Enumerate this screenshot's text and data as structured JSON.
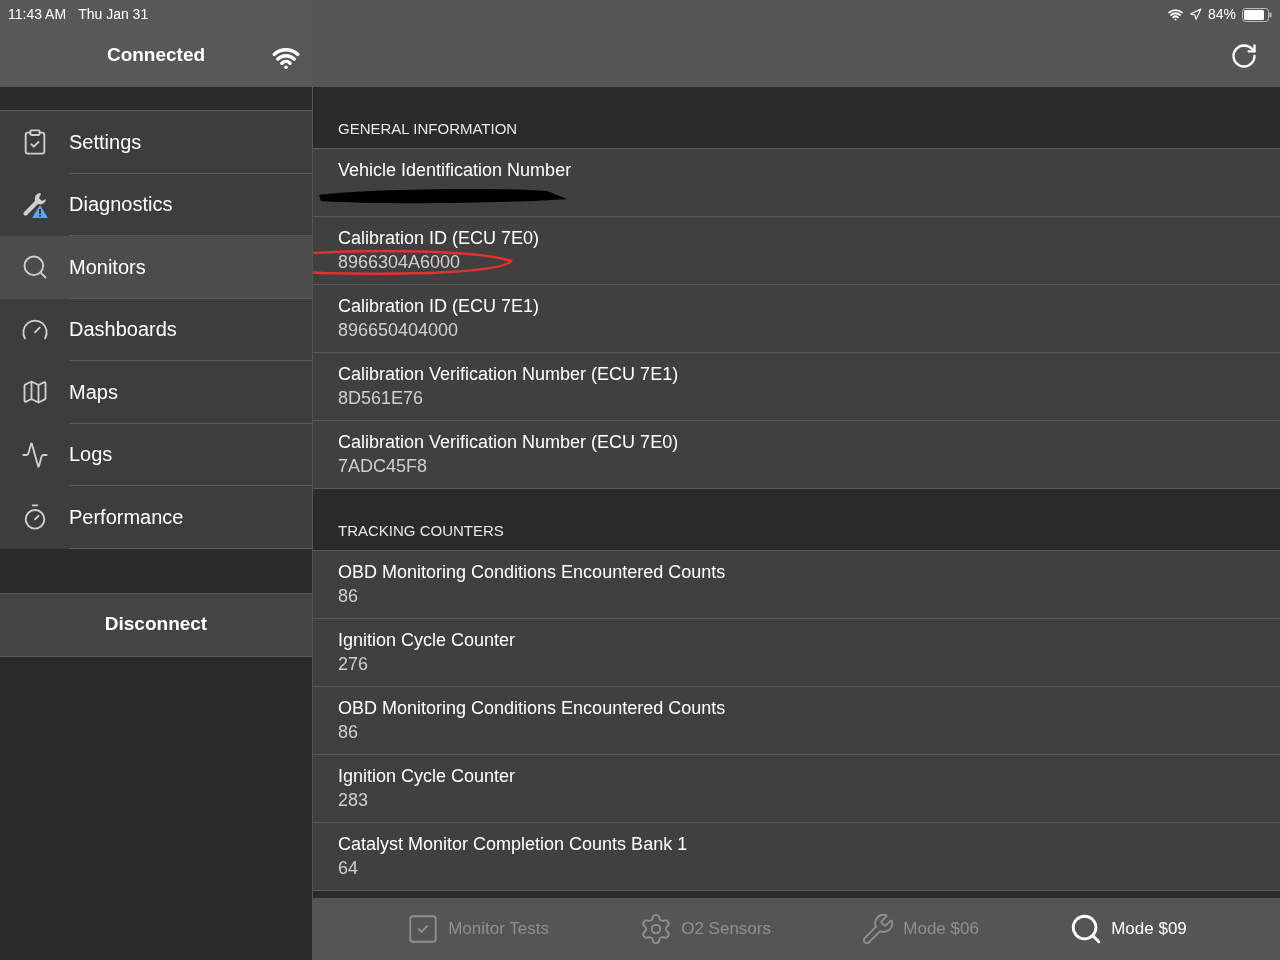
{
  "status_bar": {
    "time": "11:43 AM",
    "date": "Thu Jan 31",
    "battery": "84%"
  },
  "sidebar": {
    "title": "Connected",
    "items": [
      {
        "label": "Settings",
        "selected": false
      },
      {
        "label": "Diagnostics",
        "selected": false
      },
      {
        "label": "Monitors",
        "selected": true
      },
      {
        "label": "Dashboards",
        "selected": false
      },
      {
        "label": "Maps",
        "selected": false
      },
      {
        "label": "Logs",
        "selected": false
      },
      {
        "label": "Performance",
        "selected": false
      }
    ],
    "disconnect": "Disconnect"
  },
  "sections": [
    {
      "title": "GENERAL INFORMATION",
      "rows": [
        {
          "kind": "redacted",
          "label": "Vehicle Identification Number",
          "highlighted": false
        },
        {
          "kind": "text",
          "label": "Calibration ID (ECU 7E0)",
          "value": "8966304A6000",
          "highlighted": true
        },
        {
          "kind": "text",
          "label": "Calibration ID (ECU 7E1)",
          "value": "896650404000",
          "highlighted": false
        },
        {
          "kind": "text",
          "label": "Calibration Verification Number (ECU 7E1)",
          "value": "8D561E76",
          "highlighted": false
        },
        {
          "kind": "text",
          "label": "Calibration Verification Number (ECU 7E0)",
          "value": "7ADC45F8",
          "highlighted": false
        }
      ]
    },
    {
      "title": "TRACKING COUNTERS",
      "rows": [
        {
          "kind": "text",
          "label": "OBD Monitoring Conditions Encountered Counts",
          "value": "86",
          "highlighted": false
        },
        {
          "kind": "text",
          "label": "Ignition Cycle Counter",
          "value": "276",
          "highlighted": false
        },
        {
          "kind": "text",
          "label": "OBD Monitoring Conditions Encountered Counts",
          "value": "86",
          "highlighted": false
        },
        {
          "kind": "text",
          "label": "Ignition Cycle Counter",
          "value": "283",
          "highlighted": false
        },
        {
          "kind": "text",
          "label": "Catalyst Monitor Completion Counts Bank 1",
          "value": "64",
          "highlighted": false
        }
      ]
    }
  ],
  "tab_bar": [
    {
      "label": "Monitor Tests",
      "selected": false
    },
    {
      "label": "O2 Sensors",
      "selected": false
    },
    {
      "label": "Mode $06",
      "selected": false
    },
    {
      "label": "Mode $09",
      "selected": true
    }
  ]
}
